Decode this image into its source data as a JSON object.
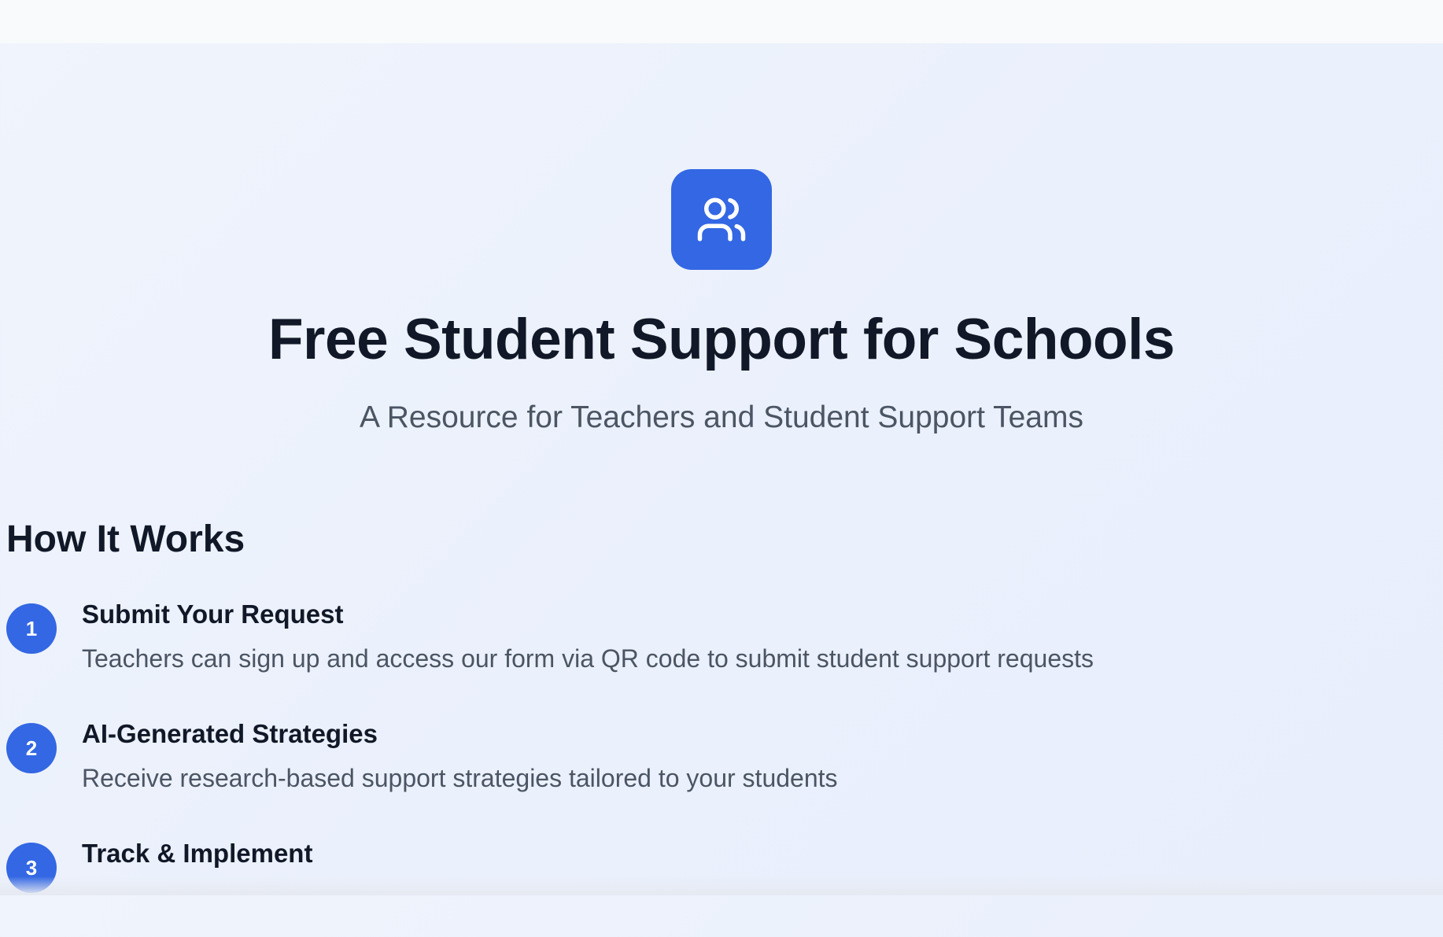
{
  "hero": {
    "icon": "users-icon",
    "title": "Free Student Support for Schools",
    "subtitle": "A Resource for Teachers and Student Support Teams"
  },
  "how_it_works": {
    "heading": "How It Works",
    "steps": [
      {
        "number": "1",
        "title": "Submit Your Request",
        "description": "Teachers can sign up and access our form via QR code to submit student support requests"
      },
      {
        "number": "2",
        "title": "AI-Generated Strategies",
        "description": "Receive research-based support strategies tailored to your students"
      },
      {
        "number": "3",
        "title": "Track & Implement",
        "description": ""
      }
    ]
  },
  "colors": {
    "accent": "#3367e3",
    "heading": "#111827",
    "body_text": "#4b5563",
    "background": "#eef3fc"
  }
}
